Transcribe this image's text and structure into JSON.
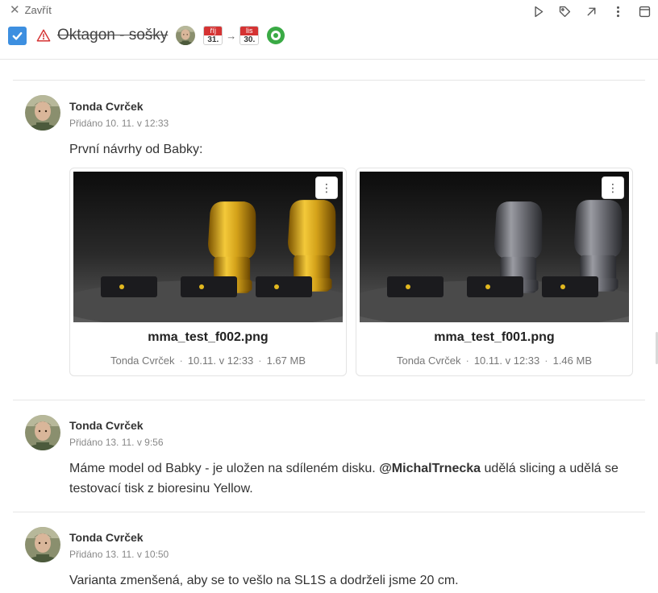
{
  "header": {
    "close_label": "Zavřít",
    "task_title": "Oktagon - sošky",
    "start_date": {
      "month": "říj",
      "day": "31."
    },
    "end_date": {
      "month": "lis",
      "day": "30."
    },
    "arrow": "→",
    "toolbar_icons": [
      "play-icon",
      "tag-icon",
      "external-link-icon",
      "more-vertical-icon",
      "panel-icon"
    ]
  },
  "comments": [
    {
      "author": "Tonda Cvrček",
      "date": "Přidáno 10. 11. v 12:33",
      "text": "První návrhy od Babky:",
      "attachments": [
        {
          "name": "mma_test_f002.png",
          "author": "Tonda Cvrček",
          "date": "10.11. v 12:33",
          "size": "1.67 MB",
          "tone": "gold"
        },
        {
          "name": "mma_test_f001.png",
          "author": "Tonda Cvrček",
          "date": "10.11. v 12:33",
          "size": "1.46 MB",
          "tone": "gray"
        }
      ]
    },
    {
      "author": "Tonda Cvrček",
      "date": "Přidáno 13. 11. v 9:56",
      "text_before": "Máme model od Babky - je uložen na sdíleném disku. ",
      "mention": "@MichalTrnecka",
      "text_after": " udělá slicing a udělá se testovací tisk z bioresinu Yellow."
    },
    {
      "author": "Tonda Cvrček",
      "date": "Přidáno 13. 11. v 10:50",
      "text": "Varianta zmenšená, aby se to vešlo na SL1S a dodrželi jsme 20 cm."
    }
  ],
  "colors": {
    "accent": "#3d8fe0",
    "warning": "#d53333",
    "status": "#3aaa45",
    "gold": "#d4a21a",
    "gray": "#6e6f76"
  }
}
